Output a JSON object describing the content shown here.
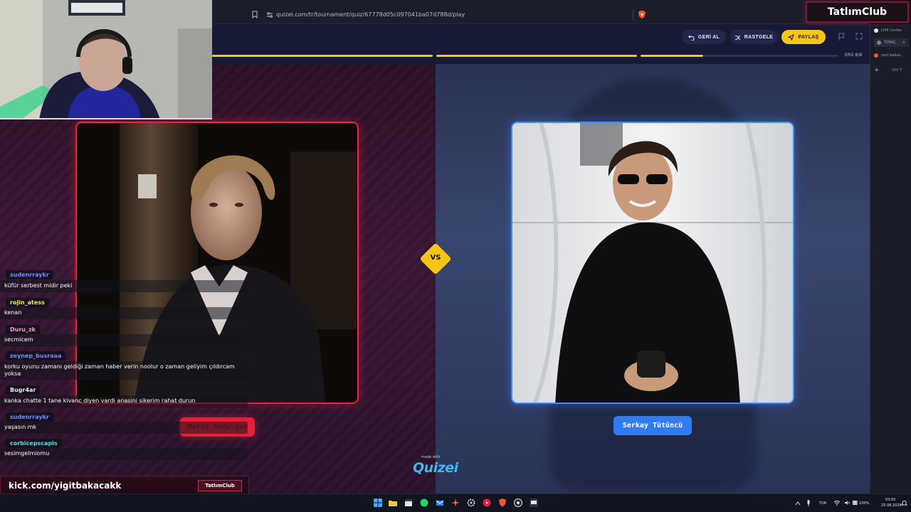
{
  "browser": {
    "url": "quizei.com/tr/tournament/quiz/67778d05c097041ba07d788d/play"
  },
  "header": {
    "back_label": "GERİ AL",
    "random_label": "RASTGELE",
    "share_label": "PAYLAŞ",
    "round_label": "8/8",
    "round_prefix": "ERG"
  },
  "side_panel": {
    "items": [
      "LIVE Center",
      "TÜRKÇ",
      "cem babau",
      "Ctrl T"
    ]
  },
  "contest": {
    "vs_label": "VS",
    "left_name": "Metin Akdülger",
    "right_name": "Serkay Tütüncü",
    "made_with": "made with",
    "logo": "Quizei"
  },
  "chat": {
    "messages": [
      {
        "user": "sudenrraykr",
        "text": "küfür serbest midir peki",
        "color": "#7a8cff"
      },
      {
        "user": "rojin_atess",
        "text": "kenan",
        "color": "#eef24a"
      },
      {
        "user": "Duru_zk",
        "text": "secmicem",
        "color": "#ff9acb"
      },
      {
        "user": "zeynep_busraaa",
        "text": "korku oyunu zamanı geldiği zaman haber verin noolur o zaman geliyim çıldırcam yoksa",
        "color": "#7a8cff"
      },
      {
        "user": "Bugr4ar",
        "text": "kanka chatte 1 tane kivanc diyen vardi anasini sikerim rahat durun",
        "color": "#e8e8e8"
      },
      {
        "user": "sudenrraykr",
        "text": "yaşasın mk",
        "color": "#7a8cff"
      },
      {
        "user": "corbicepscapls",
        "text": "sesimgelmiomu",
        "color": "#4fe3e6"
      }
    ]
  },
  "stream": {
    "channel_url": "kick.com/yigitbakacakk",
    "badge": "TatlımClub",
    "brand": "TatlımClub"
  },
  "taskbar": {
    "lang": "TUR",
    "battery": "100%",
    "time": "03:05",
    "date": "25.08.2026"
  },
  "colors": {
    "accent_yellow": "#f5c518",
    "left_red": "#ef2340",
    "right_blue": "#3d8bff"
  }
}
